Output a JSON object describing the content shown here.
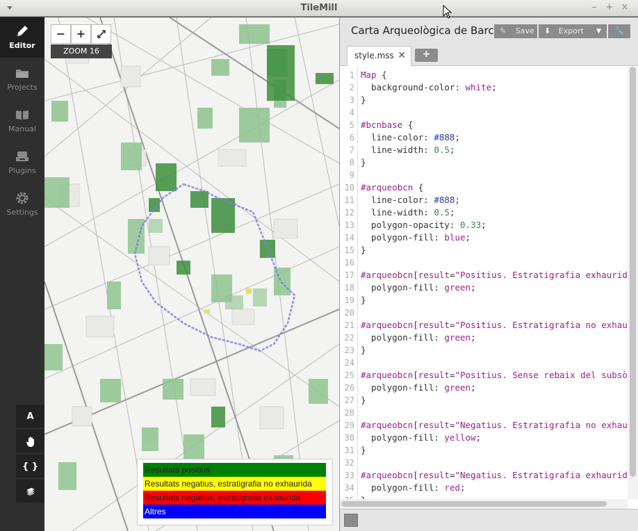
{
  "window": {
    "title": "TileMill"
  },
  "sidebar": {
    "items": [
      {
        "label": "Editor",
        "icon": "pencil-icon",
        "active": true
      },
      {
        "label": "Projects",
        "icon": "folder-icon",
        "active": false
      },
      {
        "label": "Manual",
        "icon": "book-icon",
        "active": false
      },
      {
        "label": "Plugins",
        "icon": "plugin-icon",
        "active": false
      },
      {
        "label": "Settings",
        "icon": "gear-icon",
        "active": false
      }
    ]
  },
  "map": {
    "zoom_out": "−",
    "zoom_in": "+",
    "zoom_label": "ZOOM 16",
    "tools": [
      "A",
      "hand-icon",
      "{ }",
      "layers-icon"
    ],
    "legend": [
      {
        "label": "Resultats positius",
        "color": "#008000"
      },
      {
        "label": "Resultats negatius, estratigrafia no exhaurida",
        "color": "#ffff00"
      },
      {
        "label": "Resultats negatius, estratigrafia exhaurida",
        "color": "#ff0000"
      },
      {
        "label": "Altres",
        "color": "#0000ff"
      }
    ]
  },
  "editor": {
    "project_title": "Carta Arqueològica de Barcelona",
    "save_label": "Save",
    "export_label": "Export",
    "tab_name": "style.mss",
    "add_tab": "+",
    "lines": [
      "Map {",
      "  background-color: white;",
      "}",
      "",
      "#bcnbase {",
      "  line-color: #888;",
      "  line-width: 0.5;",
      "}",
      "",
      "#arqueobcn {",
      "  line-color: #888;",
      "  line-width: 0.5;",
      "  polygon-opacity: 0.33;",
      "  polygon-fill: blue;",
      "}",
      "",
      "#arqueobcn[result=\"Positius. Estratigrafia exhaurida\"] {",
      "  polygon-fill: green;",
      "}",
      "",
      "#arqueobcn[result=\"Positius. Estratigrafia no exhaurida\"] {",
      "  polygon-fill: green;",
      "}",
      "",
      "#arqueobcn[result=\"Positius. Sense rebaix del subsòl\"] {",
      "  polygon-fill: green;",
      "}",
      "",
      "#arqueobcn[result=\"Negatius. Estratigrafia no exhaurida\"] {",
      "  polygon-fill: yellow;",
      "}",
      "",
      "#arqueobcn[result=\"Negatius. Estratigrafia exhaurida\"] {",
      "  polygon-fill: red;",
      "}"
    ]
  }
}
